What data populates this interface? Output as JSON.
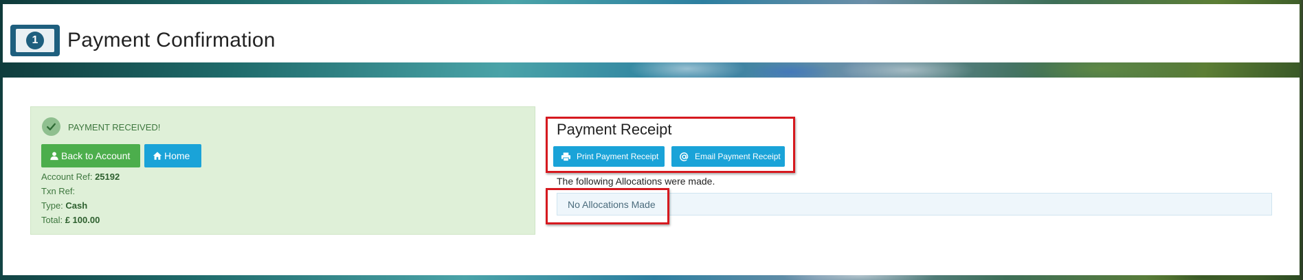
{
  "header": {
    "title": "Payment Confirmation",
    "logo_number": "1"
  },
  "success": {
    "message": "PAYMENT RECEIVED!",
    "back_button": "Back to Account",
    "home_button": "Home",
    "account_ref_label": "Account Ref:",
    "account_ref_value": "25192",
    "txn_ref_label": "Txn Ref:",
    "txn_ref_value": "",
    "type_label": "Type:",
    "type_value": "Cash",
    "total_label": "Total:",
    "total_value": "£ 100.00"
  },
  "receipt": {
    "title": "Payment Receipt",
    "print_button": "Print Payment Receipt",
    "email_button": "Email Payment Receipt",
    "allocations_text": "The following Allocations were made.",
    "no_allocations": "No Allocations Made"
  },
  "icons": {
    "logo": "banknote-icon",
    "check": "check-circle-icon",
    "back": "user-icon",
    "home": "home-icon",
    "print": "printer-icon",
    "email": "at-sign-icon"
  },
  "colors": {
    "success_bg": "#dff0d8",
    "success_text": "#3c763d",
    "btn_green": "#4cae4c",
    "btn_blue": "#1aa3d8",
    "highlight_red": "#d6191f",
    "logo_blue": "#1e5f7e"
  }
}
